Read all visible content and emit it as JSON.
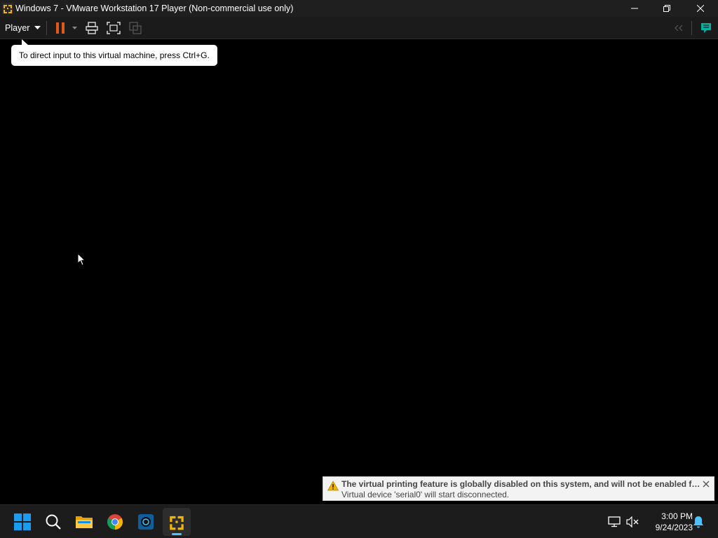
{
  "window": {
    "title": "Windows 7 - VMware Workstation 17 Player (Non-commercial use only)"
  },
  "toolbar": {
    "player_label": "Player"
  },
  "tooltip": {
    "text": "To direct input to this virtual machine, press Ctrl+G."
  },
  "notification": {
    "title": "The virtual printing feature is globally disabled on this system, and will not be enabled for this virtual machine.",
    "body": "Virtual device 'serial0' will start disconnected."
  },
  "taskbar": {
    "apps": [
      "start-icon",
      "search-icon",
      "file-explorer-icon",
      "chrome-icon",
      "app-icon",
      "vmware-player-icon"
    ],
    "clock_time": "3:00 PM",
    "clock_date": "9/24/2023"
  },
  "colors": {
    "accent": "#4cc2ff",
    "pause": "#e0581c",
    "vmware": "#f4b400"
  }
}
